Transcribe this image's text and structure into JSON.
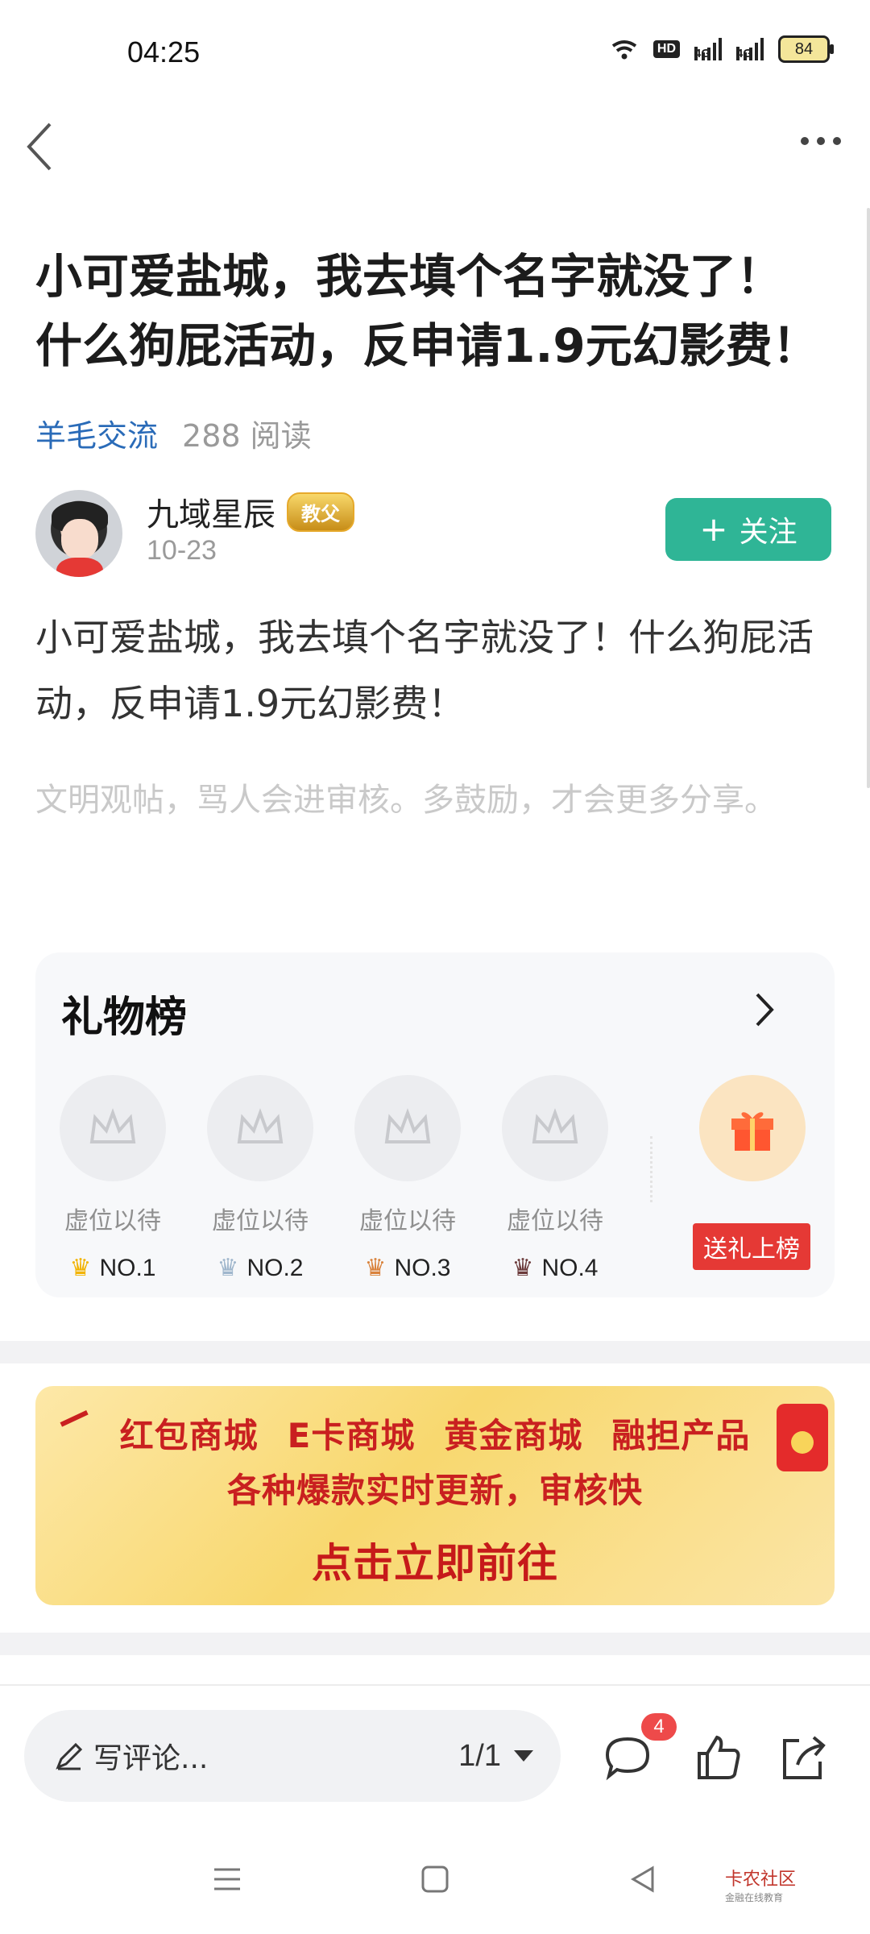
{
  "status_bar": {
    "time": "04:25",
    "network_a": "4G",
    "network_b": "4G",
    "hd": "HD",
    "battery": "84"
  },
  "post": {
    "title": "小可爱盐城，我去填个名字就没了！什么狗屁活动，反申请1.9元幻影费！",
    "board": "羊毛交流",
    "reads": "288 阅读",
    "author": "九域星辰",
    "author_badge": "教父",
    "date": "10-23",
    "follow_label": "关注",
    "body": "小可爱盐城，我去填个名字就没了！什么狗屁活动，反申请1.9元幻影费！",
    "hint": "文明观帖，骂人会进审核。多鼓励，才会更多分享。"
  },
  "gift_board": {
    "title": "礼物榜",
    "slots": [
      {
        "label": "虚位以待",
        "rank": "NO.1"
      },
      {
        "label": "虚位以待",
        "rank": "NO.2"
      },
      {
        "label": "虚位以待",
        "rank": "NO.3"
      },
      {
        "label": "虚位以待",
        "rank": "NO.4"
      }
    ],
    "send_button": "送礼上榜"
  },
  "banner": {
    "items": [
      "红包商城",
      "E卡商城",
      "黄金商城",
      "融担产品"
    ],
    "subtitle": "各种爆款实时更新，审核快",
    "cta": "点击立即前往"
  },
  "bottom_bar": {
    "comment_placeholder": "写评论...",
    "page_indicator": "1/1",
    "comment_count": "4"
  },
  "watermark": {
    "name": "卡农社区",
    "slogan": "金融在线教育"
  },
  "colors": {
    "accent_green": "#2fb596",
    "link_blue": "#2a6bb8",
    "badge_red": "#e53935"
  }
}
